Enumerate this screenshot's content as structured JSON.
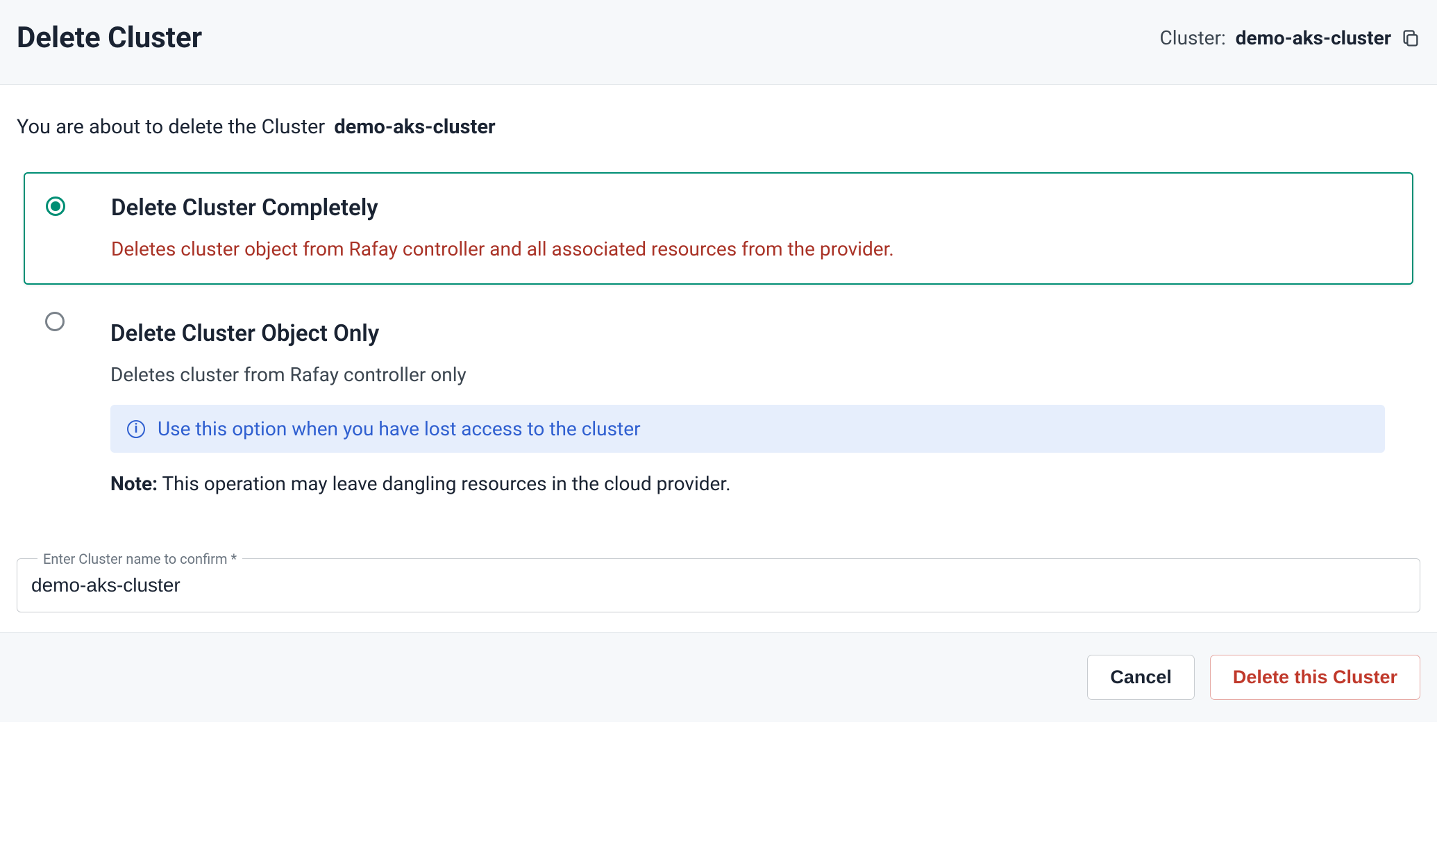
{
  "header": {
    "title": "Delete Cluster",
    "cluster_label": "Cluster:",
    "cluster_name": "demo-aks-cluster"
  },
  "intro": {
    "prefix": "You are about to delete the Cluster",
    "name": "demo-aks-cluster"
  },
  "options": {
    "completely": {
      "title": "Delete Cluster Completely",
      "desc": "Deletes cluster object from Rafay controller and all associated resources from the provider."
    },
    "object_only": {
      "title": "Delete Cluster Object Only",
      "desc": "Deletes cluster from Rafay controller only",
      "info": "Use this option when you have lost access to the cluster",
      "note_label": "Note:",
      "note_text": " This operation may leave dangling resources in the cloud provider."
    }
  },
  "confirm": {
    "label": "Enter Cluster name to confirm *",
    "value": "demo-aks-cluster"
  },
  "footer": {
    "cancel": "Cancel",
    "delete": "Delete this Cluster"
  }
}
